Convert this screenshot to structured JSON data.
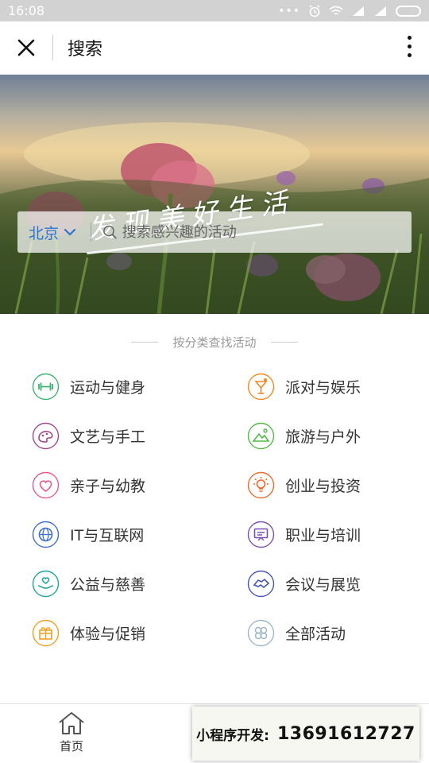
{
  "statusbar": {
    "time": "16:08",
    "dots": "•••"
  },
  "navbar": {
    "title": "搜索"
  },
  "hero": {
    "slogan": "发现美好生活"
  },
  "search": {
    "city": "北京",
    "placeholder": "搜索感兴趣的活动",
    "value": ""
  },
  "section": {
    "title": "按分类查找活动"
  },
  "categories": [
    {
      "label": "运动与健身",
      "icon": "dumbbell-icon",
      "color": "#3cb371"
    },
    {
      "label": "派对与娱乐",
      "icon": "cocktail-icon",
      "color": "#f08a24"
    },
    {
      "label": "文艺与手工",
      "icon": "palette-icon",
      "color": "#a0478c"
    },
    {
      "label": "旅游与户外",
      "icon": "mountain-icon",
      "color": "#52b84a"
    },
    {
      "label": "亲子与幼教",
      "icon": "heart-icon",
      "color": "#e85a8a"
    },
    {
      "label": "创业与投资",
      "icon": "lightbulb-icon",
      "color": "#ec6a2a"
    },
    {
      "label": "IT与互联网",
      "icon": "globe-icon",
      "color": "#3d6fd1"
    },
    {
      "label": "职业与培训",
      "icon": "presentation-icon",
      "color": "#7a4fb5"
    },
    {
      "label": "公益与慈善",
      "icon": "charity-hands-icon",
      "color": "#1ea39a"
    },
    {
      "label": "会议与展览",
      "icon": "handshake-icon",
      "color": "#4552b8"
    },
    {
      "label": "体验与促销",
      "icon": "gift-icon",
      "color": "#f0a020"
    },
    {
      "label": "全部活动",
      "icon": "clover-icon",
      "color": "#9db7c9"
    }
  ],
  "tabbar": {
    "home_label": "首页",
    "home_icon": "home-icon"
  },
  "promo": {
    "label": "小程序开发:",
    "number": "13691612727"
  }
}
